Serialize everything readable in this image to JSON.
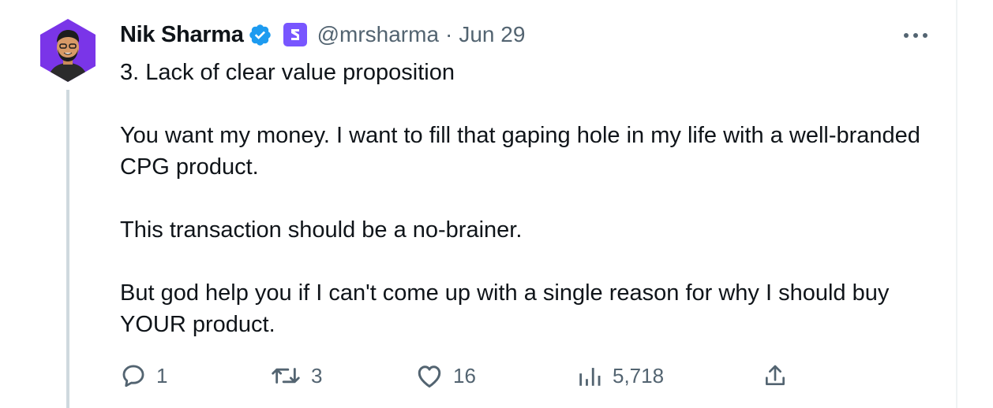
{
  "tweet": {
    "author": {
      "name": "Nik Sharma",
      "handle": "@mrsharma",
      "avatar": "avatar-illustration",
      "verified": true,
      "affiliate_badge_icon": "affiliate-badge-icon"
    },
    "separator": "·",
    "date": "Jun 29",
    "paragraphs": [
      "3. Lack of clear value proposition",
      "You want my money. I want to fill that gaping hole in my life with a well-branded CPG product.",
      "This transaction should be a no-brainer.",
      "But god help you if I can't come up with a single reason for why I should buy YOUR product."
    ],
    "actions": {
      "reply": {
        "icon": "reply-icon",
        "count": "1"
      },
      "retweet": {
        "icon": "retweet-icon",
        "count": "3"
      },
      "like": {
        "icon": "heart-icon",
        "count": "16"
      },
      "views": {
        "icon": "views-icon",
        "count": "5,718"
      },
      "share": {
        "icon": "share-icon"
      }
    }
  },
  "colors": {
    "text_primary": "#0f1419",
    "text_secondary": "#536471",
    "verified_blue": "#1d9bf0",
    "badge_purple": "#7856ff",
    "thread_line": "#cfd9de"
  }
}
